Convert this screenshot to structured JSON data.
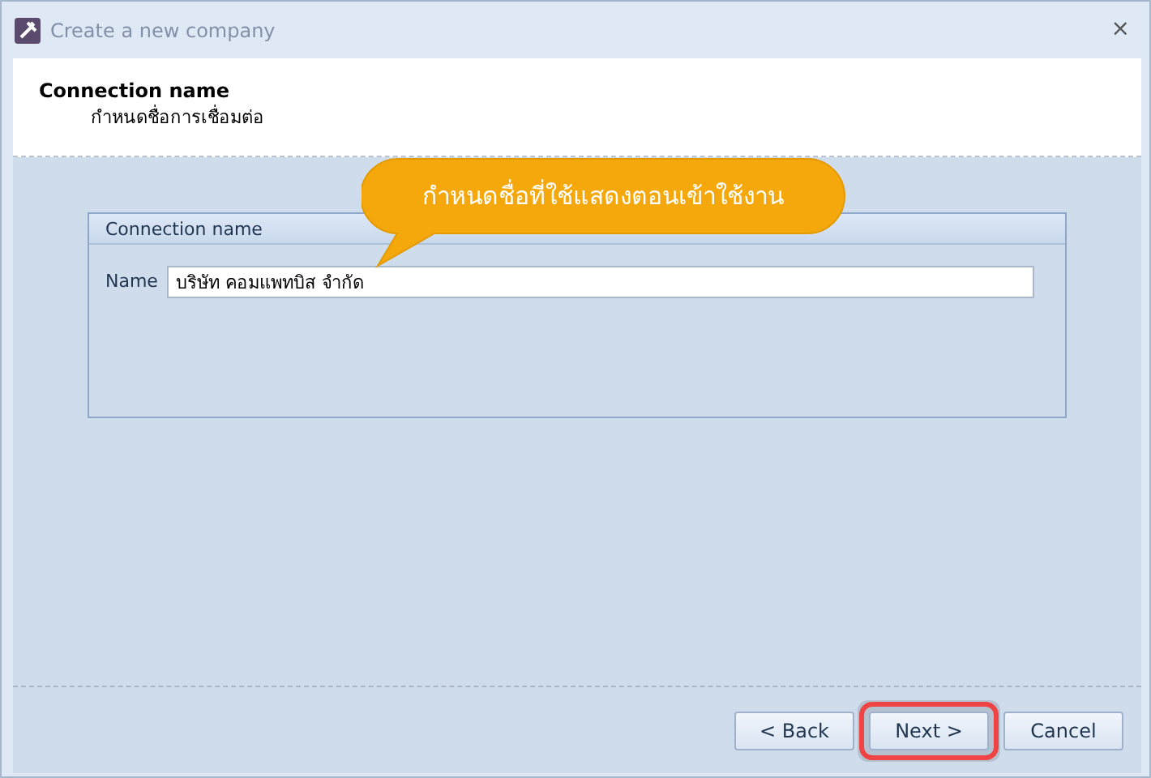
{
  "window": {
    "title": "Create a new company",
    "close": "⨯"
  },
  "header": {
    "title": "Connection name",
    "subtitle": "กำหนดชื่อการเชื่อมต่อ"
  },
  "callout": {
    "text": "กำหนดชื่อที่ใช้แสดงตอนเข้าใช้งาน"
  },
  "group": {
    "title": "Connection name",
    "fields": [
      {
        "label": "Name",
        "value": "บริษัท คอมแพทบิส จำกัด"
      }
    ]
  },
  "buttons": [
    {
      "label": "< Back",
      "highlighted": false
    },
    {
      "label": "Next >",
      "highlighted": true
    },
    {
      "label": "Cancel",
      "highlighted": false
    }
  ]
}
